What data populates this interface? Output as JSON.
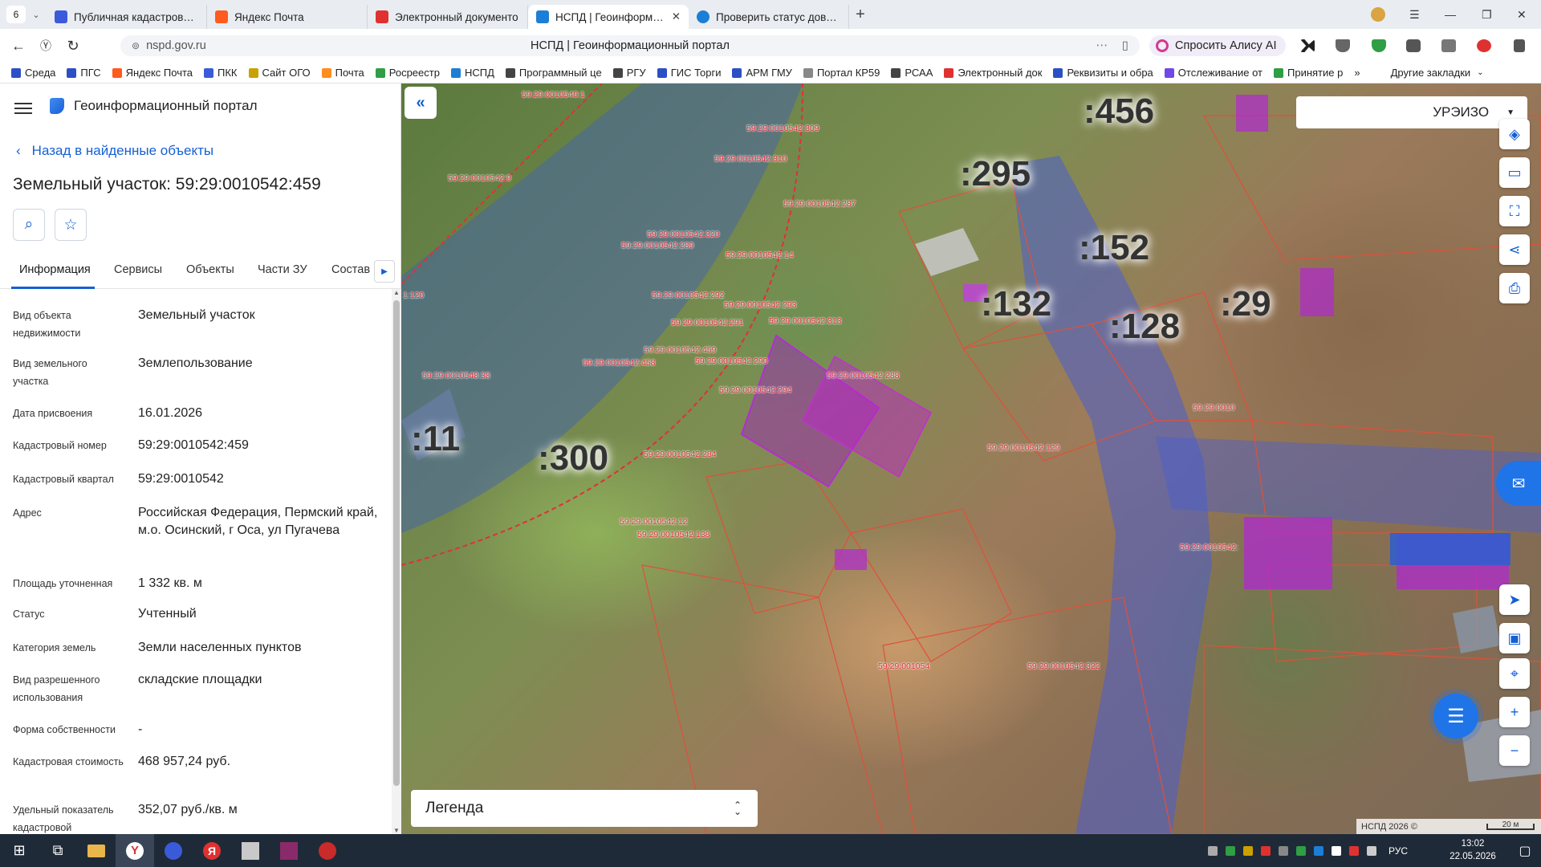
{
  "browser": {
    "tab_count": "6",
    "tabs": [
      {
        "label": "Публичная кадастровая к",
        "color": "#3b5bdb"
      },
      {
        "label": "Яндекс Почта",
        "color": "#ff5a1f"
      },
      {
        "label": "Электронный документо",
        "color": "#e03131"
      },
      {
        "label": "НСПД | Геоинформаци",
        "color": "#1c7ed6"
      },
      {
        "label": "Проверить статус довере",
        "color": "#1c7ed6"
      }
    ],
    "url": "nspd.gov.ru",
    "page_title": "НСПД | Геоинформационный портал",
    "alisa_label": "Спросить Алису AI",
    "bookmarks": [
      {
        "label": "Среда",
        "color": "#2b4fc4"
      },
      {
        "label": "ПГС",
        "color": "#2b4fc4"
      },
      {
        "label": "Яндекс Почта",
        "color": "#ff5a1f"
      },
      {
        "label": "ПКК",
        "color": "#3b5bdb"
      },
      {
        "label": "Сайт ОГО",
        "color": "#c9a100"
      },
      {
        "label": "Почта",
        "color": "#ff8c1f"
      },
      {
        "label": "Росреестр",
        "color": "#2f9e44"
      },
      {
        "label": "НСПД",
        "color": "#1c7ed6"
      },
      {
        "label": "Программный це",
        "color": "#444"
      },
      {
        "label": "РГУ",
        "color": "#444"
      },
      {
        "label": "ГИС Торги",
        "color": "#2b4fc4"
      },
      {
        "label": "АРМ ГМУ",
        "color": "#2b4fc4"
      },
      {
        "label": "Портал КР59",
        "color": "#888"
      },
      {
        "label": "РСАА",
        "color": "#444"
      },
      {
        "label": "Электронный док",
        "color": "#e03131"
      },
      {
        "label": "Реквизиты и обра",
        "color": "#2b4fc4"
      },
      {
        "label": "Отслеживание от",
        "color": "#7048e8"
      },
      {
        "label": "Принятие р",
        "color": "#2f9e44"
      }
    ],
    "bookmarks_more": "»",
    "other_bookmarks": "Другие закладки"
  },
  "panel": {
    "portal_name": "Геоинформационный портал",
    "back_link": "Назад в найденные объекты",
    "title": "Земельный участок: 59:29:0010542:459",
    "tabs": [
      "Информация",
      "Сервисы",
      "Объекты",
      "Части ЗУ",
      "Состав"
    ],
    "fields": [
      {
        "k": "Вид объекта недвижимости",
        "v": "Земельный участок"
      },
      {
        "k": "Вид земельного участка",
        "v": "Землепользование"
      },
      {
        "k": "Дата присвоения",
        "v": "16.01.2026"
      },
      {
        "k": "Кадастровый номер",
        "v": "59:29:0010542:459"
      },
      {
        "k": "Кадастровый квартал",
        "v": "59:29:0010542"
      },
      {
        "k": "Адрес",
        "v": "Российская Федерация, Пермский край, м.о. Осинский, г Оса, ул Пугачева"
      },
      {
        "k": "Площадь уточненная",
        "v": "1 332 кв. м"
      },
      {
        "k": "Статус",
        "v": "Учтенный"
      },
      {
        "k": "Категория земель",
        "v": "Земли населенных пунктов"
      },
      {
        "k": "Вид разрешенного использования",
        "v": "складские площадки"
      },
      {
        "k": "Форма собственности",
        "v": "-"
      },
      {
        "k": "Кадастровая стоимость",
        "v": "468 957,24 руб."
      },
      {
        "k": "Удельный показатель кадастровой",
        "v": "352,07 руб./кв. м"
      }
    ]
  },
  "map": {
    "layer_select": "УРЭИЗО",
    "legend": "Легенда",
    "attribution": "НСПД 2026 ©",
    "scale": "20 м",
    "big_labels": [
      ":295",
      ":152",
      ":132",
      ":128",
      ":29",
      ":11",
      ":300",
      ":456"
    ],
    "parcel_labels": [
      "59:29:0010540:1",
      "59:29:0010542:309",
      "59:29:0010542:310",
      "59:29:0010542:9",
      "59:29:0010542:287",
      "59:29:0010542:320",
      "59:29:0010542:289",
      "59:29:0010542:14",
      "59:29:0010542:292",
      "59:29:0010542:293",
      "59:29:0010542:291",
      "59:29:0010542:313",
      "59:29:0010542:459",
      "59:29:0010542:290",
      "59:29:0010542:458",
      "59:29:0010548:38",
      "59:29:0010542:288",
      "59:29:0010542:294",
      "59:29:0010542:284",
      "59:29:0010542:129",
      "59:29:0010542:12",
      "59:29:0010542:138",
      "59:29:001054",
      "59:29:0010542:322",
      "1:120",
      "59:29:0010542:",
      "59:29:0010"
    ]
  },
  "taskbar": {
    "lang": "РУС",
    "time": "13:02",
    "date": "22.05.2026"
  }
}
